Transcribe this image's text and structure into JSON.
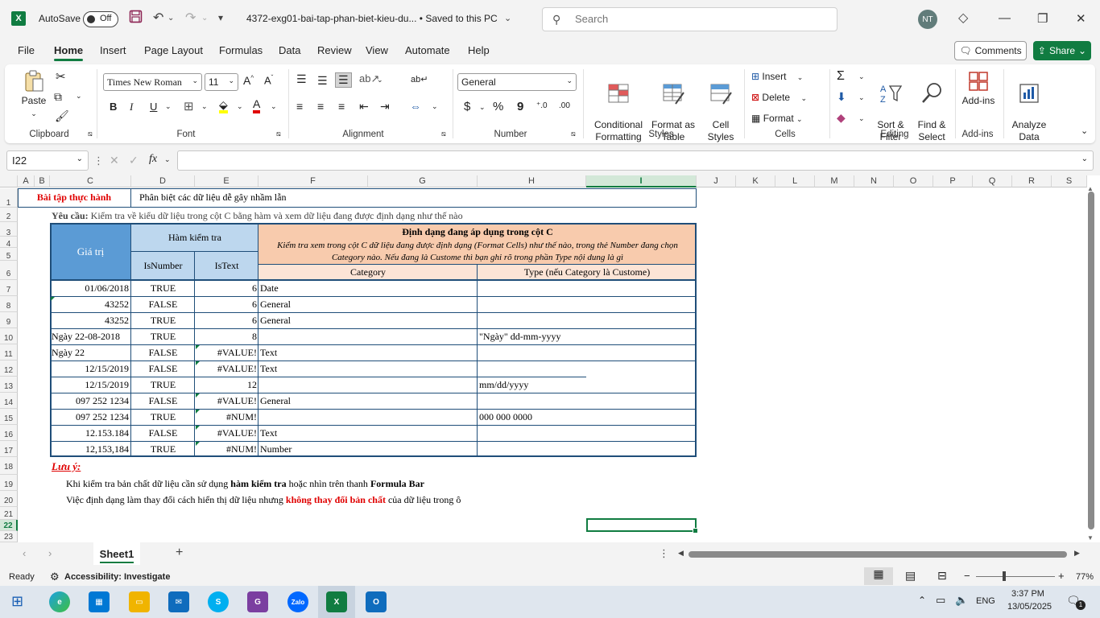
{
  "titlebar": {
    "autosave_label": "AutoSave",
    "autosave_state": "Off",
    "doc_title": "4372-exg01-bai-tap-phan-biet-kieu-du...  •  Saved to this PC",
    "search_placeholder": "Search",
    "avatar_initials": "NT"
  },
  "tabs": [
    "File",
    "Home",
    "Insert",
    "Page Layout",
    "Formulas",
    "Data",
    "Review",
    "View",
    "Automate",
    "Help"
  ],
  "actions": {
    "comments": "Comments",
    "share": "Share"
  },
  "ribbon": {
    "clipboard": {
      "paste": "Paste",
      "label": "Clipboard"
    },
    "font": {
      "name": "Times New Roman",
      "size": "11",
      "label": "Font",
      "bold": "B",
      "italic": "I",
      "underline": "U"
    },
    "alignment": {
      "label": "Alignment"
    },
    "number": {
      "format": "General",
      "label": "Number",
      "currency": "$",
      "percent": "%",
      "comma": "9"
    },
    "styles": {
      "conditional": "Conditional\nFormatting",
      "format_table": "Format as\nTable",
      "cell_styles": "Cell\nStyles",
      "label": "Styles"
    },
    "cells": {
      "insert": "Insert",
      "delete": "Delete",
      "format": "Format",
      "label": "Cells"
    },
    "editing": {
      "sort_filter": "Sort &\nFilter",
      "find_select": "Find &\nSelect",
      "label": "Editing"
    },
    "addins": {
      "addins": "Add-ins",
      "label": "Add-ins"
    },
    "analyze": {
      "label": "Analyze\nData"
    }
  },
  "formula_bar": {
    "name_box": "I22",
    "fx": "fx",
    "content": ""
  },
  "columns": [
    "A",
    "B",
    "C",
    "D",
    "E",
    "F",
    "G",
    "H",
    "I",
    "J",
    "K",
    "L",
    "M",
    "N",
    "O",
    "P",
    "Q",
    "R",
    "S"
  ],
  "rows": [
    "1",
    "2",
    "3",
    "4",
    "5",
    "6",
    "7",
    "8",
    "9",
    "10",
    "11",
    "12",
    "13",
    "14",
    "15",
    "16",
    "17",
    "18",
    "19",
    "20",
    "21",
    "22",
    "23"
  ],
  "sheet": {
    "title_label": "Bài tập thực hành",
    "title_text": "Phân biệt các dữ liệu dễ gây nhầm lẫn",
    "req_label": "Yêu cầu:",
    "req_text": " Kiểm tra về kiểu dữ liệu trong cột C bằng hàm và xem dữ liệu đang được định dạng như thế nào",
    "hdr_value": "Giá trị",
    "hdr_check": "Hàm kiểm tra",
    "hdr_isnumber": "IsNumber",
    "hdr_istext": "IsText",
    "hdr_format": "Định dạng đang áp dụng trong cột C",
    "hdr_format_desc1": "Kiểm tra xem trong cột C dữ liệu đang được định dạng (Format Cells) như thế nào, trong thẻ Number đang chọn",
    "hdr_format_desc2": "Category nào. Nếu đang là Custome thì bạn ghi rõ trong phần Type nội dung là gì",
    "hdr_category": "Category",
    "hdr_type": "Type (nếu Category là Custome)",
    "rows": [
      {
        "value": "01/06/2018",
        "align": "r",
        "isnumber": "TRUE",
        "istext": "6",
        "category": "Date",
        "type": ""
      },
      {
        "value": "43252",
        "align": "r",
        "isnumber": "FALSE",
        "istext": "6",
        "category": "General",
        "type": ""
      },
      {
        "value": "43252",
        "align": "r",
        "isnumber": "TRUE",
        "istext": "6",
        "category": "General",
        "type": ""
      },
      {
        "value": "Ngày 22-08-2018",
        "align": "l",
        "isnumber": "TRUE",
        "istext": "8",
        "category": "",
        "type": "\"Ngày\" dd-mm-yyyy"
      },
      {
        "value": "Ngày 22",
        "align": "l",
        "isnumber": "FALSE",
        "istext": "#VALUE!",
        "category": "Text",
        "type": ""
      },
      {
        "value": "12/15/2019",
        "align": "r",
        "isnumber": "FALSE",
        "istext": "#VALUE!",
        "category": "Text",
        "type": ""
      },
      {
        "value": "12/15/2019",
        "align": "r",
        "isnumber": "TRUE",
        "istext": "12",
        "category": "",
        "type": "mm/dd/yyyy"
      },
      {
        "value": "097 252 1234",
        "align": "r",
        "isnumber": "FALSE",
        "istext": "#VALUE!",
        "category": "General",
        "type": ""
      },
      {
        "value": "097 252 1234",
        "align": "r",
        "isnumber": "TRUE",
        "istext": "#NUM!",
        "category": "",
        "type": "000 000 0000"
      },
      {
        "value": "12.153.184",
        "align": "r",
        "isnumber": "FALSE",
        "istext": "#VALUE!",
        "category": "Text",
        "type": ""
      },
      {
        "value": "12,153,184",
        "align": "r",
        "isnumber": "TRUE",
        "istext": "#NUM!",
        "category": "Number",
        "type": ""
      }
    ],
    "note_label": "Lưu ý:",
    "note1_a": "Khi kiểm tra bản chất dữ liệu cần sử dụng ",
    "note1_b": "hàm kiểm tra",
    "note1_c": " hoặc nhìn trên thanh ",
    "note1_d": "Formula Bar",
    "note2_a": "Việc định dạng làm thay đổi cách hiển thị dữ liệu nhưng ",
    "note2_b": "không thay đổi bản chất",
    "note2_c": " của dữ liệu trong ô"
  },
  "sheet_tab": "Sheet1",
  "status": {
    "ready": "Ready",
    "accessibility": "Accessibility: Investigate",
    "zoom": "77%"
  },
  "taskbar": {
    "lang": "ENG",
    "time": "3:37 PM",
    "date": "13/05/2025",
    "notif": "1"
  },
  "colors": {
    "excel_green": "#107c41",
    "header_blue": "#bdd7ee",
    "header_peach": "#f8cbad",
    "red": "#e00000"
  }
}
